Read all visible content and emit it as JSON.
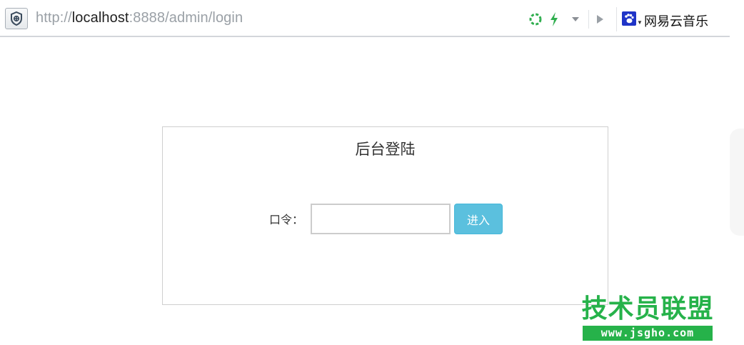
{
  "browser": {
    "url_scheme": "http://",
    "url_host": "localhost",
    "url_rest": ":8888/admin/login",
    "search_engine_icon": "baidu-paw-icon",
    "search_text": "网易云音乐",
    "icons": [
      "shield-icon",
      "refresh-icon",
      "lightning-icon",
      "dropdown-icon",
      "play-icon"
    ]
  },
  "login": {
    "title": "后台登陆",
    "password_label": "口令：",
    "password_value": "",
    "enter_button": "进入"
  },
  "watermark": {
    "title": "技术员联盟",
    "url": "www.jsgho.com"
  },
  "colors": {
    "button": "#5bc0de",
    "watermark": "#26b24a",
    "panel_border": "#cfcfcf"
  }
}
